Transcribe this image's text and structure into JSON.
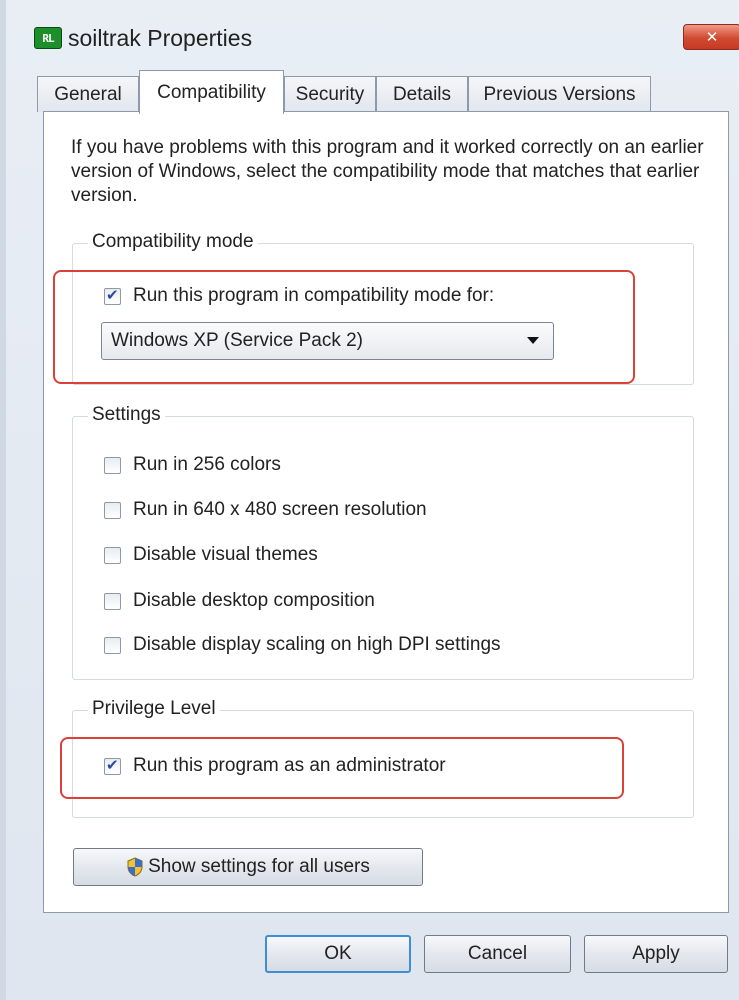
{
  "window": {
    "title": "soiltrak Properties",
    "app_icon_text": "RL",
    "close_glyph": "✕"
  },
  "tabs": [
    {
      "label": "General"
    },
    {
      "label": "Compatibility"
    },
    {
      "label": "Security"
    },
    {
      "label": "Details"
    },
    {
      "label": "Previous Versions"
    }
  ],
  "intro": "If you have problems with this program and it worked correctly on an earlier version of Windows, select the compatibility mode that matches that earlier version.",
  "compat_mode": {
    "group_label": "Compatibility mode",
    "checkbox_label": "Run this program in compatibility mode for:",
    "checked": true,
    "selected_os": "Windows XP (Service Pack 2)"
  },
  "settings": {
    "group_label": "Settings",
    "items": [
      {
        "label": "Run in 256 colors",
        "checked": false
      },
      {
        "label": "Run in 640 x 480 screen resolution",
        "checked": false
      },
      {
        "label": "Disable visual themes",
        "checked": false
      },
      {
        "label": "Disable desktop composition",
        "checked": false
      },
      {
        "label": "Disable display scaling on high DPI settings",
        "checked": false
      }
    ]
  },
  "privilege": {
    "group_label": "Privilege Level",
    "checkbox_label": "Run this program as an administrator",
    "checked": true
  },
  "show_settings_button": "Show settings for all users",
  "footer": {
    "ok": "OK",
    "cancel": "Cancel",
    "apply": "Apply"
  },
  "colors": {
    "highlight": "#d9423a",
    "default_button_border": "#3b8fd2"
  },
  "icons": {
    "app": "app-icon",
    "close": "close-icon",
    "dropdown": "chevron-down-icon",
    "shield": "uac-shield-icon"
  }
}
